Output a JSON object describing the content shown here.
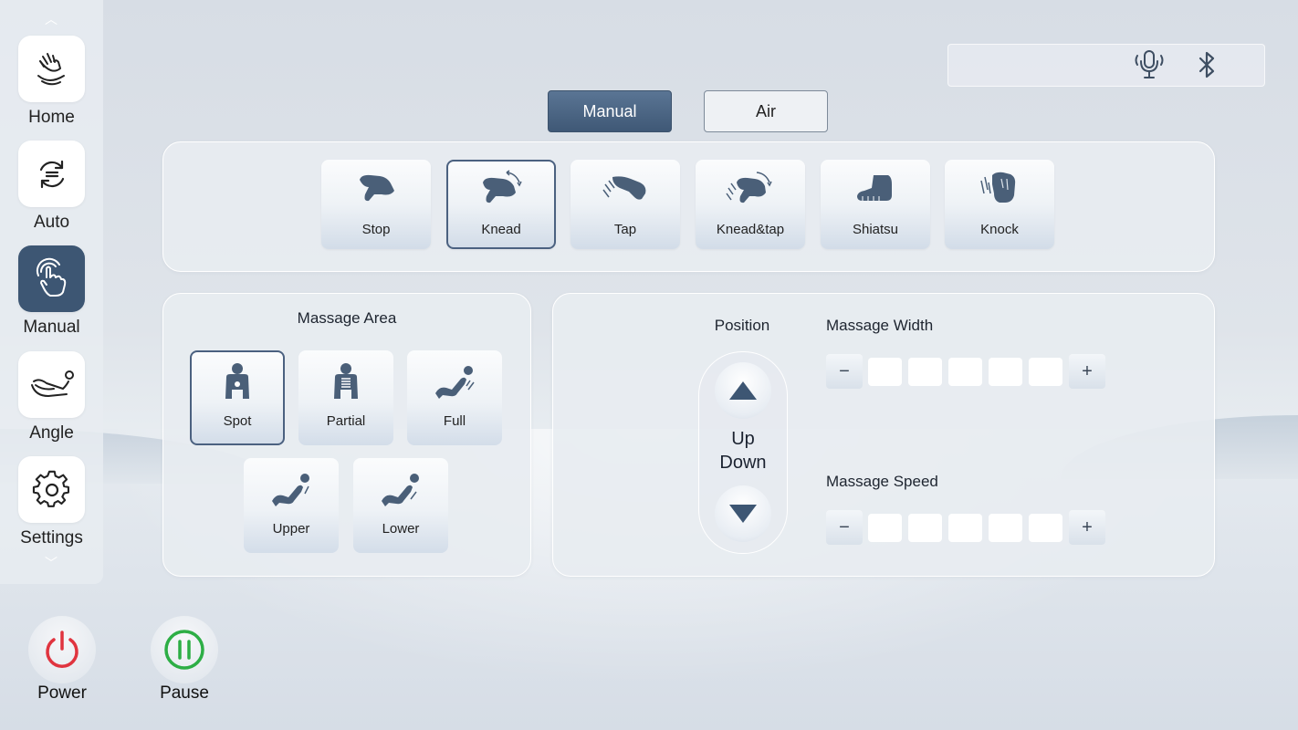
{
  "sidebar": {
    "items": [
      {
        "label": "Home",
        "icon": "hand-massage-icon"
      },
      {
        "label": "Auto",
        "icon": "refresh-icon"
      },
      {
        "label": "Manual",
        "icon": "hand-touch-icon",
        "active": true
      },
      {
        "label": "Angle",
        "icon": "recline-angle-icon"
      },
      {
        "label": "Settings",
        "icon": "gear-icon"
      }
    ]
  },
  "status": {
    "icons": [
      "voice-icon",
      "bluetooth-icon"
    ]
  },
  "tabs": [
    {
      "label": "Manual",
      "active": true
    },
    {
      "label": "Air",
      "active": false
    }
  ],
  "techniques": [
    {
      "label": "Stop",
      "icon": "stop-hand-icon"
    },
    {
      "label": "Knead",
      "icon": "knead-icon",
      "selected": true
    },
    {
      "label": "Tap",
      "icon": "tap-icon"
    },
    {
      "label": "Knead&tap",
      "icon": "knead-tap-icon"
    },
    {
      "label": "Shiatsu",
      "icon": "shiatsu-icon"
    },
    {
      "label": "Knock",
      "icon": "knock-icon"
    }
  ],
  "massage_area": {
    "title": "Massage Area",
    "options": [
      {
        "label": "Spot",
        "icon": "spot-body-icon",
        "selected": true
      },
      {
        "label": "Partial",
        "icon": "partial-body-icon"
      },
      {
        "label": "Full",
        "icon": "full-recline-icon"
      },
      {
        "label": "Upper",
        "icon": "upper-recline-icon"
      },
      {
        "label": "Lower",
        "icon": "lower-recline-icon"
      }
    ]
  },
  "position": {
    "title": "Position",
    "up_label": "Up",
    "down_label": "Down"
  },
  "massage_width": {
    "title": "Massage Width",
    "minus": "−",
    "plus": "+",
    "level": 0,
    "max": 5
  },
  "massage_speed": {
    "title": "Massage Speed",
    "minus": "−",
    "plus": "+",
    "level": 0,
    "max": 5
  },
  "controls": {
    "power_label": "Power",
    "pause_label": "Pause"
  },
  "colors": {
    "accent": "#4a6584",
    "icon": "#4a5f78",
    "power": "#e0343f",
    "pause": "#2dae45"
  }
}
